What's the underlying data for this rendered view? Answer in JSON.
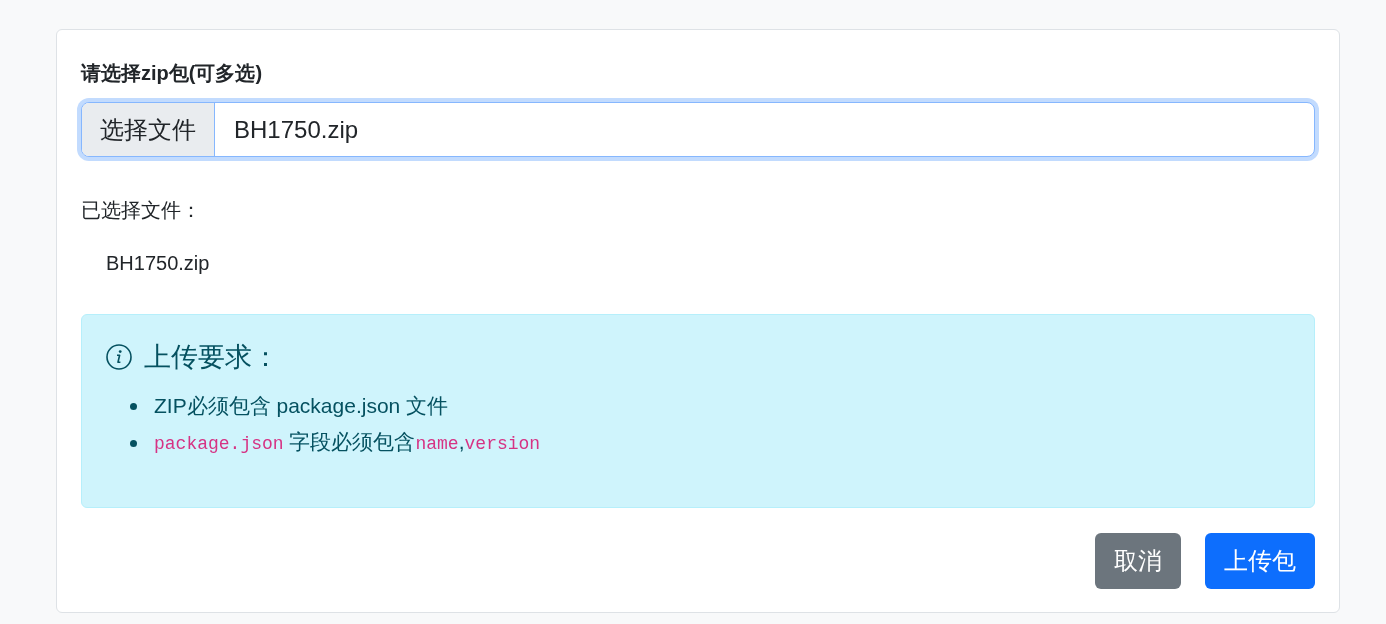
{
  "form": {
    "label": "请选择zip包(可多选)",
    "file_input": {
      "button_label": "选择文件",
      "value": "BH1750.zip",
      "focused": true
    }
  },
  "selected_files": {
    "label": "已选择文件：",
    "files": [
      "BH1750.zip"
    ]
  },
  "alert": {
    "kind": "info",
    "title": "上传要求：",
    "items": [
      {
        "segments": [
          {
            "kind": "text",
            "text": "ZIP必须包含 package.json 文件"
          }
        ]
      },
      {
        "segments": [
          {
            "kind": "code",
            "text": "package.json"
          },
          {
            "kind": "text",
            "text": " 字段必须包含"
          },
          {
            "kind": "code",
            "text": "name"
          },
          {
            "kind": "text",
            "text": ","
          },
          {
            "kind": "code",
            "text": "version"
          }
        ]
      }
    ]
  },
  "buttons": [
    {
      "label": "取消",
      "kind": "secondary"
    },
    {
      "label": "上传包",
      "kind": "primary"
    }
  ]
}
